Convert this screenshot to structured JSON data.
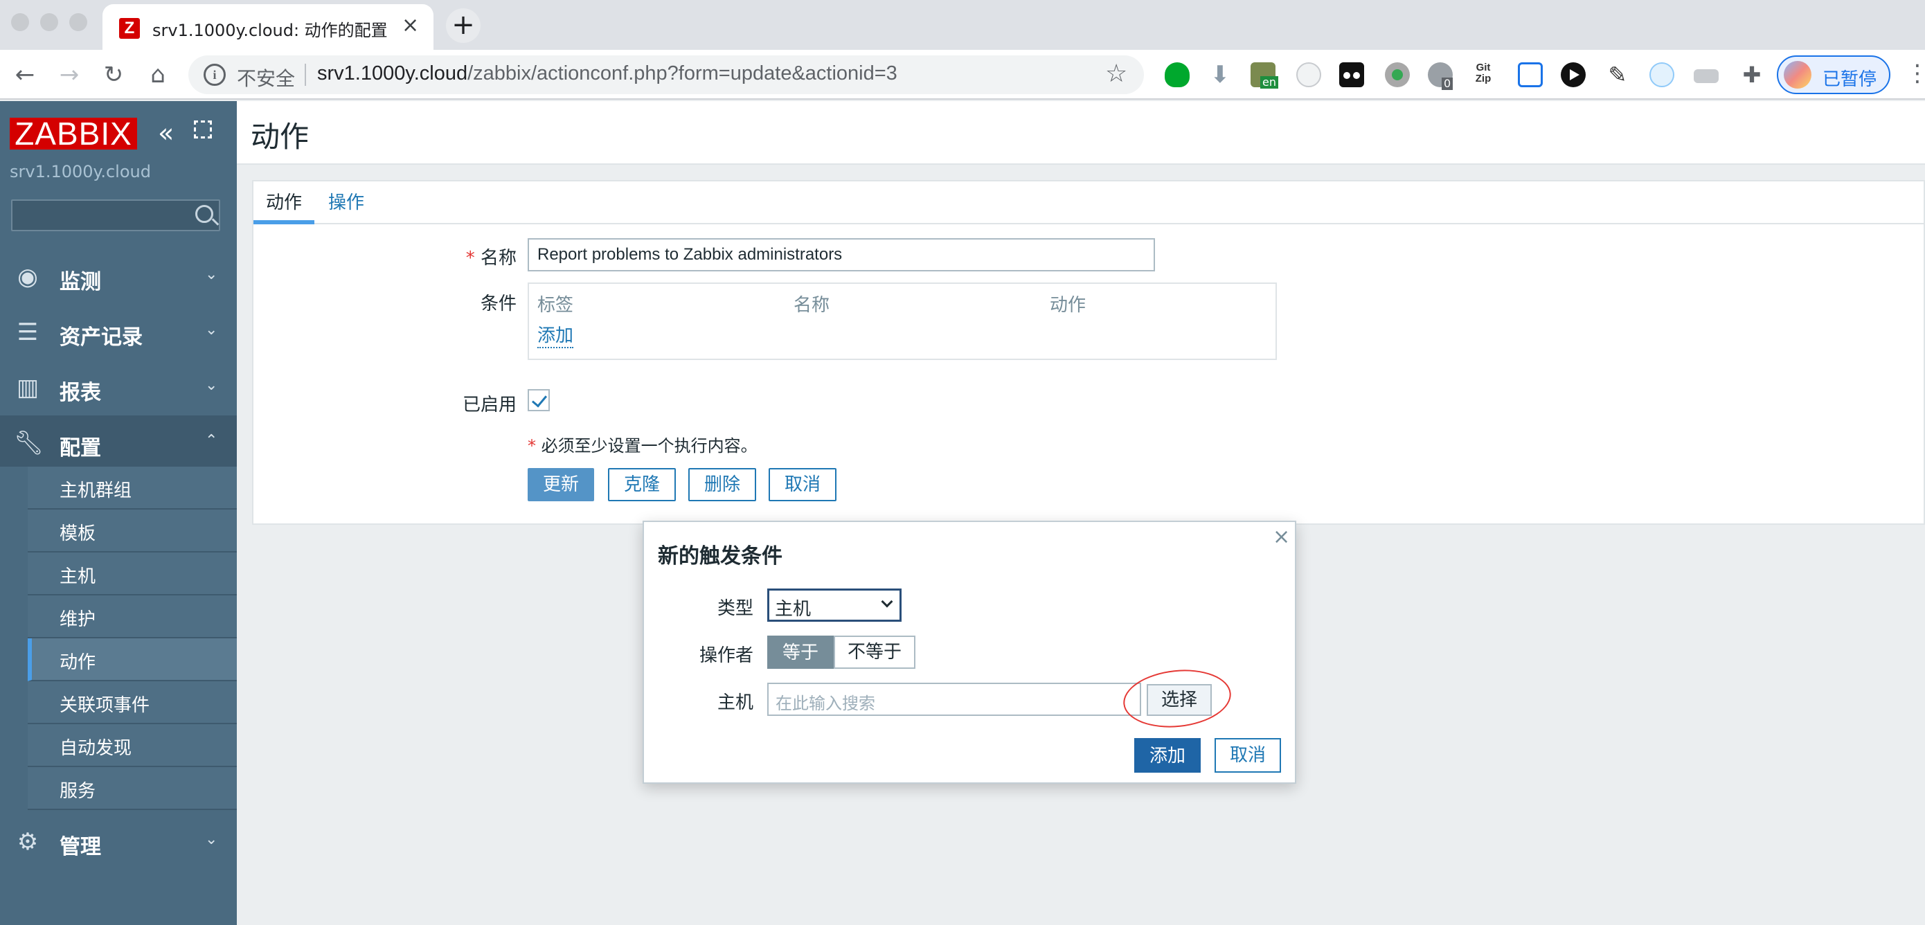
{
  "browser": {
    "tab_title": "srv1.1000y.cloud: 动作的配置",
    "tab_favicon_letter": "Z",
    "new_tab_symbol": "+",
    "security_label": "不安全",
    "url_host": "srv1.1000y.cloud",
    "url_path": "/zabbix/actionconf.php?form=update&actionid=3",
    "profile_label": "已暂停",
    "extension_icons": [
      "evernote-icon",
      "download-icon",
      "translate-icon",
      "cloud-icon",
      "tampermonkey-icon",
      "record-icon",
      "privacy-badger-icon",
      "gitzip-icon",
      "screen-share-icon",
      "video-icon",
      "pen-icon",
      "cloud-sync-icon",
      "folder-icon",
      "puzzle-icon"
    ],
    "extension_badge_en": "en",
    "extension_badge_count": "0"
  },
  "sidebar": {
    "logo": "ZABBIX",
    "server_name": "srv1.1000y.cloud",
    "search_placeholder": "",
    "menu": [
      {
        "label": "监测",
        "icon": "eye-icon"
      },
      {
        "label": "资产记录",
        "icon": "list-icon"
      },
      {
        "label": "报表",
        "icon": "bar-chart-icon"
      },
      {
        "label": "配置",
        "icon": "wrench-icon"
      },
      {
        "label": "管理",
        "icon": "gear-icon"
      }
    ],
    "submenu": [
      "主机群组",
      "模板",
      "主机",
      "维护",
      "动作",
      "关联项事件",
      "自动发现",
      "服务"
    ],
    "active_submenu": "动作"
  },
  "main": {
    "page_title": "动作",
    "tabs": [
      "动作",
      "操作"
    ],
    "form": {
      "name_label": "名称",
      "name_value": "Report problems to Zabbix administrators",
      "conditions_label": "条件",
      "conditions_columns": [
        "标签",
        "名称",
        "动作"
      ],
      "conditions_add": "添加",
      "enabled_label": "已启用",
      "enabled": true,
      "required_note": "必须至少设置一个执行内容。",
      "required_mark": "*",
      "buttons": {
        "update": "更新",
        "clone": "克隆",
        "delete": "删除",
        "cancel": "取消"
      }
    }
  },
  "dialog": {
    "title": "新的触发条件",
    "close_symbol": "×",
    "type_label": "类型",
    "type_value": "主机",
    "operator_label": "操作者",
    "operator_options": [
      "等于",
      "不等于"
    ],
    "operator_selected": "等于",
    "host_label": "主机",
    "host_placeholder": "在此输入搜索",
    "select_button": "选择",
    "add_button": "添加",
    "cancel_button": "取消"
  },
  "colors": {
    "sidebar_bg": "#4a6a80",
    "logo_red": "#d40000",
    "link_blue": "#1f78b4",
    "primary_button": "#5494c7",
    "dialog_add_button": "#1f65a6",
    "annotation_red": "#e53935"
  }
}
